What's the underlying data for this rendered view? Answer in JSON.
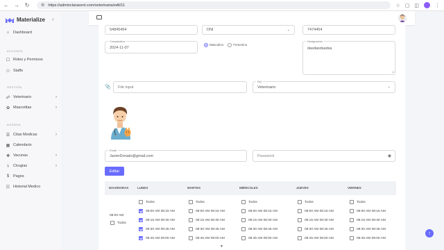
{
  "browser": {
    "url": "https://adminclaraxent.com/veterinaria/edit/11"
  },
  "sidebar": {
    "brand": "Materialize",
    "dashboard": "Dashboard",
    "section_acceso": "ACCESOS",
    "roles": "Roles y Permisos",
    "staffs": "Staffs",
    "section_gestion": "GESTIÓN",
    "veterinario": "Veterinario",
    "mascotas": "Mascotitas",
    "section_agenda": "AGENDA",
    "citas": "Citas Medicas",
    "calendario": "Calendario",
    "vacunas": "Vacunas",
    "cirugias": "Cirugias",
    "pagos": "Pagos",
    "historial": "Historial Medico"
  },
  "form": {
    "document_number": "54845454",
    "document_type": "DNI",
    "phone": "7474454",
    "birth_label": "Cumpleaños",
    "birth_value": "2024-11-07",
    "gender_male": "Masculino",
    "gender_female": "Femenino",
    "designation_label": "Designación",
    "designation_value": "dasdasdsadsa",
    "file_placeholder": "File input",
    "role_label": "Rol",
    "role_value": "Veterinario",
    "email_label": "Email",
    "email_value": "JavierDonato@gmail.com",
    "password_placeholder": "Password",
    "edit_button": "Editar"
  },
  "schedule": {
    "headers": [
      "DIAS/HORAS",
      "LUNES",
      "MARTES",
      "MIÉRCOLES",
      "JUEVES",
      "VIERNES"
    ],
    "hour_label": "08:00 AM",
    "all_label": "Todos",
    "slots": [
      "08:00 AM 08:15 AM",
      "08:15 AM 08:30 AM",
      "08:30 AM 08:45 AM",
      "08:45 AM 09:00 AM"
    ],
    "monday_checked": [
      true,
      true,
      true,
      true
    ]
  },
  "colors": {
    "accent": "#696cff"
  }
}
